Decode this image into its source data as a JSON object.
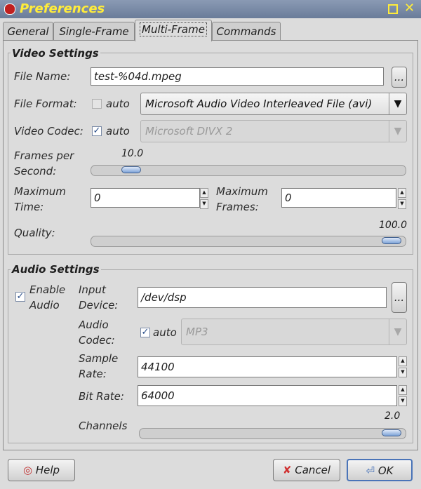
{
  "window": {
    "title": "Preferences"
  },
  "tabs": [
    {
      "label": "General"
    },
    {
      "label": "Single-Frame"
    },
    {
      "label": "Multi-Frame"
    },
    {
      "label": "Commands"
    }
  ],
  "video": {
    "section_title": "Video Settings",
    "file_name": {
      "label": "File Name:",
      "value": "test-%04d.mpeg",
      "browse_label": "..."
    },
    "file_format": {
      "label": "File Format:",
      "auto_label": "auto",
      "auto_checked": false,
      "selected": "Microsoft Audio Video Interleaved File (avi)"
    },
    "video_codec": {
      "label": "Video Codec:",
      "auto_label": "auto",
      "auto_checked": true,
      "selected": "Microsoft DIVX 2"
    },
    "fps": {
      "label_line1": "Frames per",
      "label_line2": "Second:",
      "value_text": "10.0",
      "value": 10.0
    },
    "max_time": {
      "label_line1": "Maximum",
      "label_line2": "Time:",
      "value": "0"
    },
    "max_frames": {
      "label_line1": "Maximum",
      "label_line2": "Frames:",
      "value": "0"
    },
    "quality": {
      "label": "Quality:",
      "value_text": "100.0",
      "value": 100.0
    }
  },
  "audio": {
    "section_title": "Audio Settings",
    "enable": {
      "label_line1": "Enable",
      "label_line2": "Audio",
      "checked": true
    },
    "input_device": {
      "label_line1": "Input",
      "label_line2": "Device:",
      "value": "/dev/dsp",
      "browse_label": "..."
    },
    "audio_codec": {
      "label_line1": "Audio",
      "label_line2": "Codec:",
      "auto_label": "auto",
      "auto_checked": true,
      "selected": "MP3"
    },
    "sample_rate": {
      "label_line1": "Sample",
      "label_line2": "Rate:",
      "value": "44100"
    },
    "bit_rate": {
      "label": "Bit Rate:",
      "value": "64000"
    },
    "channels": {
      "label": "Channels",
      "value_text": "2.0",
      "value": 2.0
    }
  },
  "buttons": {
    "help": "Help",
    "cancel": "Cancel",
    "ok": "OK"
  },
  "colors": {
    "title_text": "#ffec3a",
    "title_bg": "#7a8ba8",
    "accent": "#4a74b8"
  }
}
